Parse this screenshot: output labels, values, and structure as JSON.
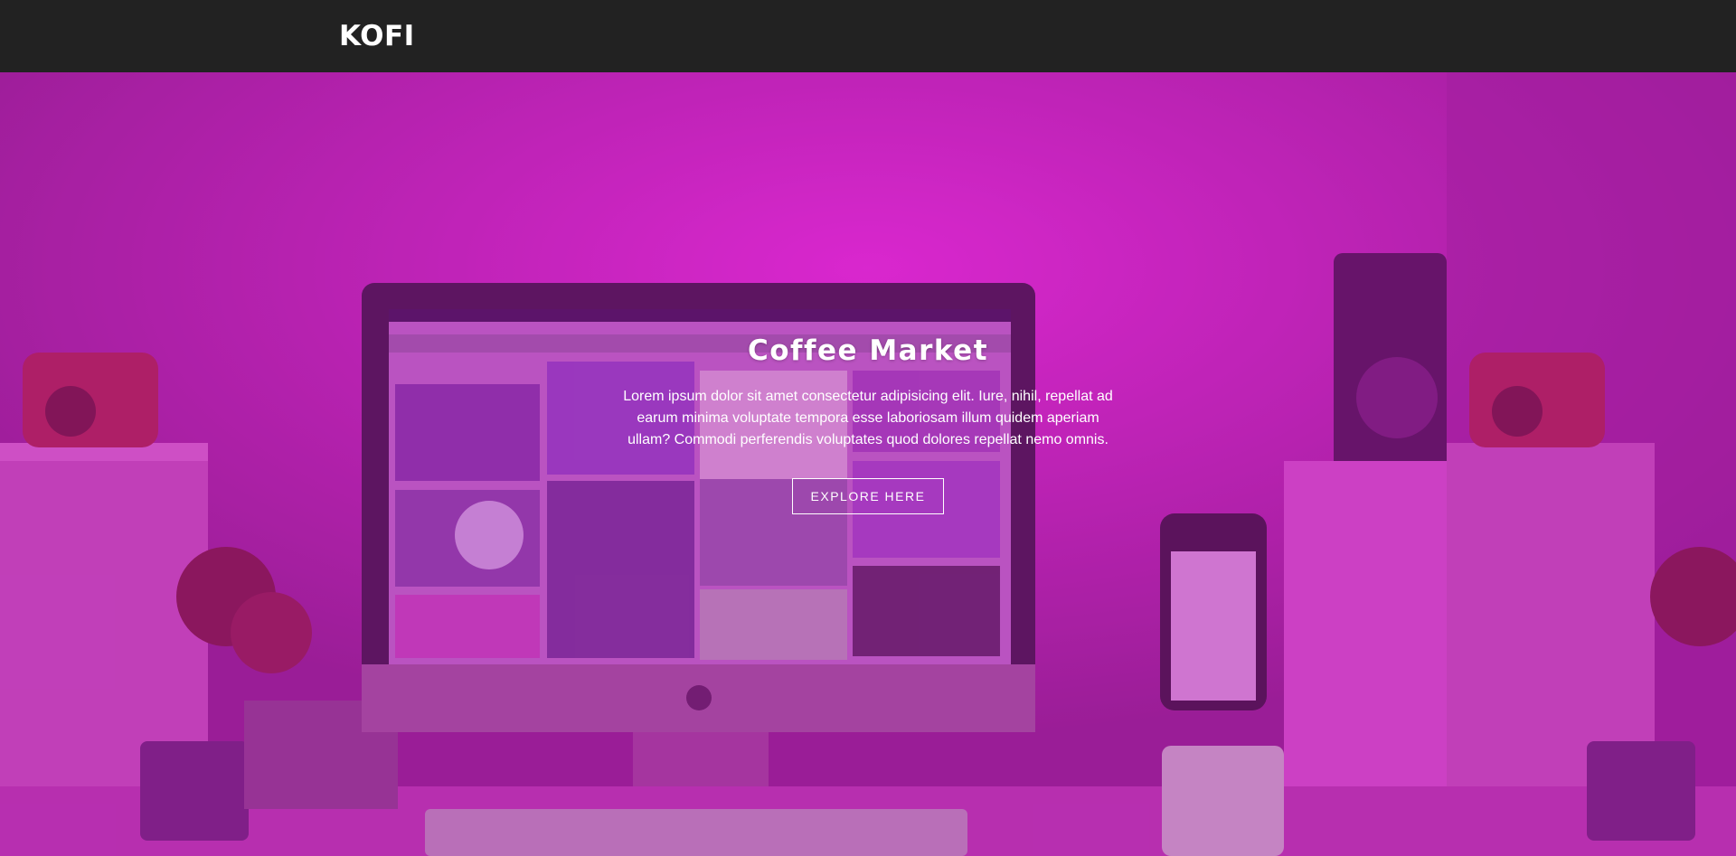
{
  "nav": {
    "brand": "KOFI"
  },
  "hero": {
    "title": "Coffee Market",
    "text": "Lorem ipsum dolor sit amet consectetur adipisicing elit. Iure, nihil, repellat ad earum minima voluptate tempora esse laboriosam illum quidem aperiam ullam? Commodi perferendis voluptates quod dolores repellat nemo omnis.",
    "button_label": "EXPLORE HERE"
  },
  "colors": {
    "navbar": "#222222",
    "overlay": "#c02bbb",
    "text": "#ffffff"
  },
  "background_image": "desk-setup-photo-magenta"
}
